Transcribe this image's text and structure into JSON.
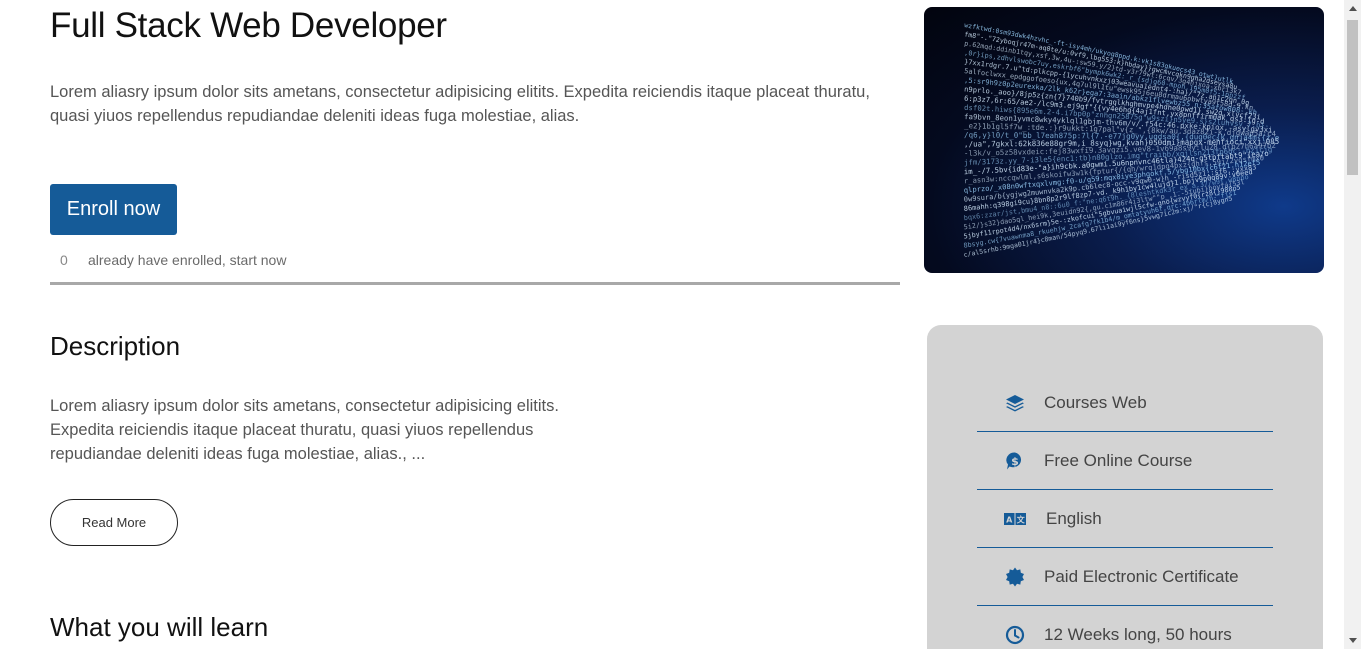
{
  "course": {
    "title": "Full Stack Web Developer",
    "intro": "Lorem aliasry ipsum dolor sits ametans, consectetur adipisicing elitits. Expedita reiciendis itaque placeat thuratu, quasi yiuos repellendus repudiandae deleniti ideas fuga molestiae, alias.",
    "enroll_label": "Enroll now",
    "enrolled_count": "0",
    "enrolled_text": "already have enrolled, start now"
  },
  "description": {
    "title": "Description",
    "text": "Lorem aliasry ipsum dolor sits ametans, consectetur adipisicing elitits. Expedita reiciendis itaque placeat thuratu, quasi yiuos repellendus repudiandae deleniti ideas fuga molestiae, alias., ...",
    "read_more_label": "Read More"
  },
  "learn": {
    "title": "What you will learn"
  },
  "info": {
    "items": [
      {
        "icon": "layers-icon",
        "label": "Courses Web"
      },
      {
        "icon": "dollar-badge-icon",
        "label": "Free Online Course"
      },
      {
        "icon": "translate-icon",
        "label": "English"
      },
      {
        "icon": "certificate-icon",
        "label": "Paid Electronic Certificate"
      },
      {
        "icon": "clock-icon",
        "label": "12 Weeks long, 50 hours"
      }
    ]
  },
  "colors": {
    "primary": "#155b98",
    "card_bg": "#d3d3d3",
    "divider": "#a8a8a8"
  }
}
